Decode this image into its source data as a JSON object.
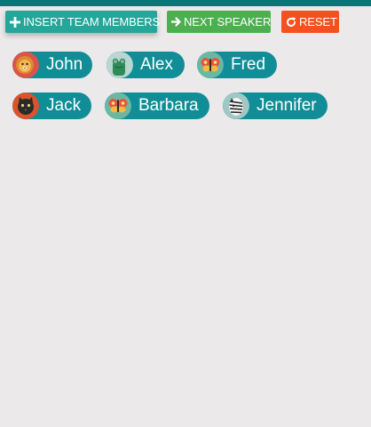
{
  "toolbar": {
    "insert_label": "INSERT TEAM MEMBERS",
    "next_label": "NEXT SPEAKER",
    "reset_label": "RESET",
    "colors": {
      "insert": "#26a69a",
      "next": "#4caf50",
      "reset": "#f4511e",
      "topbar": "#0d7377"
    }
  },
  "members": [
    {
      "name": "John",
      "avatar_icon": "lion-icon"
    },
    {
      "name": "Alex",
      "avatar_icon": "frog-icon"
    },
    {
      "name": "Fred",
      "avatar_icon": "butterfly-icon"
    },
    {
      "name": "Jack",
      "avatar_icon": "cat-icon"
    },
    {
      "name": "Barbara",
      "avatar_icon": "butterfly-icon"
    },
    {
      "name": "Jennifer",
      "avatar_icon": "zebra-icon"
    }
  ],
  "chip_color": "#118d97"
}
